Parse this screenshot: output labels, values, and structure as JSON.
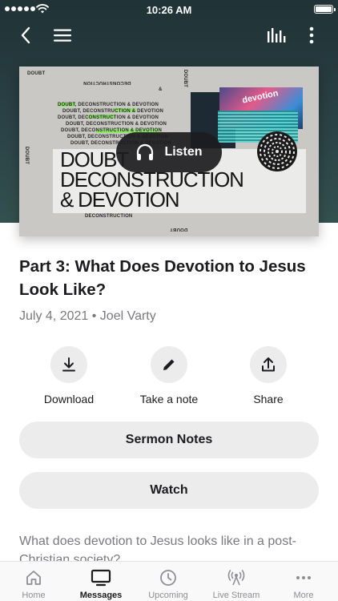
{
  "status_bar": {
    "time": "10:26 AM"
  },
  "artwork": {
    "series_title_lines": [
      "DOUBT",
      "DECONSTRUCTION",
      "& DEVOTION"
    ],
    "small_doubt": "DOUBT",
    "small_deconstruction": "DECONSTRUCTION",
    "small_amp": "&",
    "repeat_text": "DOUBT, DECONSTRUCTION & DEVOTION",
    "photo_text": "devotion"
  },
  "listen": {
    "label": "Listen"
  },
  "message": {
    "title": "Part 3: What Does Devotion to Jesus Look Like?",
    "date": "July 4, 2021",
    "separator": "•",
    "speaker": "Joel Varty"
  },
  "actions": [
    {
      "label": "Download",
      "icon": "download-icon"
    },
    {
      "label": "Take a note",
      "icon": "pencil-icon"
    },
    {
      "label": "Share",
      "icon": "share-icon"
    }
  ],
  "buttons": {
    "sermon_notes": "Sermon Notes",
    "watch": "Watch"
  },
  "description": "What does devotion to Jesus looks like in a post-Christian society?",
  "tabs": [
    {
      "label": "Home",
      "icon": "home-icon",
      "active": false
    },
    {
      "label": "Messages",
      "icon": "tv-icon",
      "active": true
    },
    {
      "label": "Upcoming",
      "icon": "clock-icon",
      "active": false
    },
    {
      "label": "Live Stream",
      "icon": "broadcast-icon",
      "active": false
    },
    {
      "label": "More",
      "icon": "ellipsis-icon",
      "active": false
    }
  ],
  "colors": {
    "header_bg": "#2b4347",
    "accent_green": "#8fe86a",
    "pill_bg": "#1c1c1e",
    "button_bg": "#ececed"
  }
}
